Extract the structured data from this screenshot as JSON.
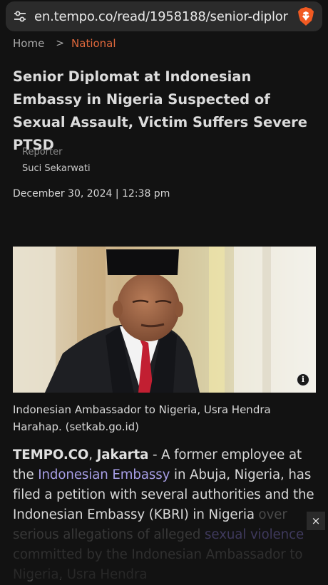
{
  "browser": {
    "url": "en.tempo.co/read/1958188/senior-diplor",
    "site_settings_icon": "tune-icon",
    "shields_icon": "brave-lion-icon"
  },
  "breadcrumb": {
    "home": "Home",
    "separator": ">",
    "section": "National"
  },
  "article": {
    "title": "Senior Diplomat at Indonesian Embassy in Nigeria Suspected of Sexual Assault, Victim Suffers Severe PTSD",
    "reporter_label": "Reporter",
    "reporter_name": "Suci Sekarwati",
    "date": "December 30, 2024 | 12:38 pm",
    "image_info_icon": "info-icon",
    "caption": "Indonesian Ambassador to Nigeria, Usra Hendra Harahap. (setkab.go.id)",
    "body": {
      "source": "TEMPO.CO",
      "source_sep": ", ",
      "location": "Jakarta",
      "dash": " - ",
      "p1": "A former employee at the ",
      "link1": "Indonesian Embassy",
      "p2": " in Abuja, Nigeria, has filed a petition with several authorities and the Indonesian Embassy (KBRI) in Nigeria ",
      "p3": "over serious allegations of alleged ",
      "link2": "sexual violence",
      "p4": " committed by the Indonesian Ambassador to Nigeria, Usra Hendra"
    }
  },
  "ad_close": {
    "label": "×"
  }
}
